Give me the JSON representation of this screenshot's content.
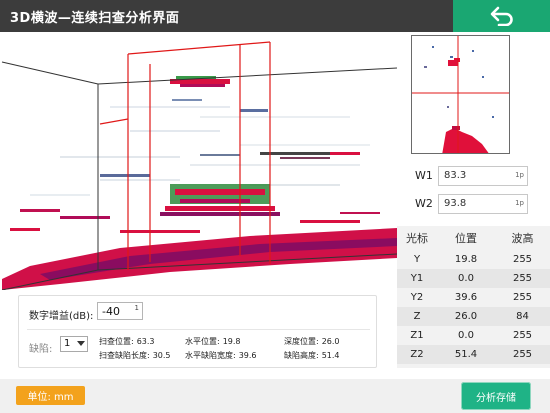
{
  "header": {
    "title": "3D横波—连续扫查分析界面",
    "back_icon": "return-arrow-icon"
  },
  "colors": {
    "title_bar": "#3c3c3c",
    "accent_green": "#1aa772",
    "unit_orange": "#f3a21c",
    "defect_red": "#e0103a",
    "cursor_line": "#e01818"
  },
  "windows": [
    {
      "label": "W1",
      "value": "83.3",
      "unit": "1p"
    },
    {
      "label": "W2",
      "value": "93.8",
      "unit": "1p"
    }
  ],
  "cursor_table": {
    "headers": [
      "光标",
      "位置",
      "波高"
    ],
    "rows": [
      {
        "name": "Y",
        "position": "19.8",
        "amplitude": "255"
      },
      {
        "name": "Y1",
        "position": "0.0",
        "amplitude": "255"
      },
      {
        "name": "Y2",
        "position": "39.6",
        "amplitude": "255"
      },
      {
        "name": "Z",
        "position": "26.0",
        "amplitude": "84"
      },
      {
        "name": "Z1",
        "position": "0.0",
        "amplitude": "255"
      },
      {
        "name": "Z2",
        "position": "51.4",
        "amplitude": "255"
      }
    ]
  },
  "gain": {
    "label": "数字增益(dB):",
    "value": "-40",
    "spin": "1"
  },
  "defect": {
    "label": "缺陷:",
    "selected": "1"
  },
  "stats": {
    "scan_position_label": "扫查位置:",
    "scan_position": "63.3",
    "horizontal_position_label": "水平位置:",
    "horizontal_position": "19.8",
    "depth_position_label": "深度位置:",
    "depth_position": "26.0",
    "scan_defect_length_label": "扫查缺陷长度:",
    "scan_defect_length": "30.5",
    "horizontal_defect_width_label": "水平缺陷宽度:",
    "horizontal_defect_width": "39.6",
    "defect_height_label": "缺陷高度:",
    "defect_height": "51.4"
  },
  "footer": {
    "unit_label": "单位:  mm",
    "save_label": "分析存储"
  }
}
